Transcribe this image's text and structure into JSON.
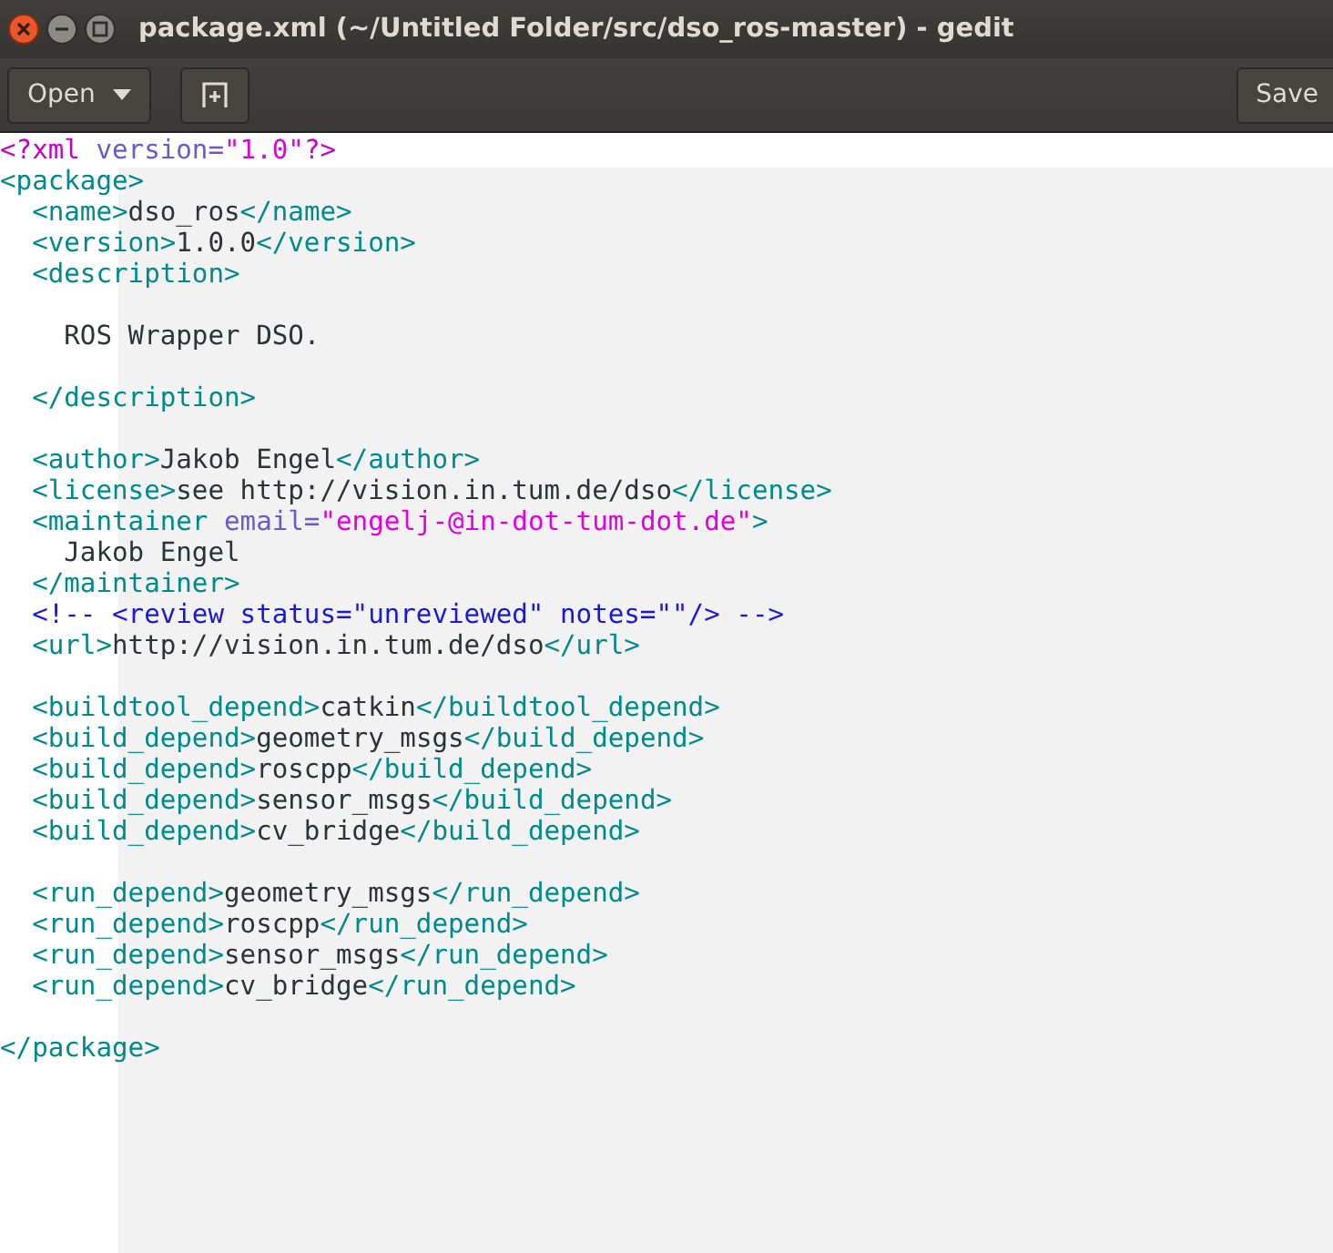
{
  "window": {
    "title": "package.xml (~/Untitled Folder/src/dso_ros-master) - gedit"
  },
  "toolbar": {
    "open_button": "Open",
    "save_button": "Save"
  },
  "editor": {
    "lines": [
      {
        "kind": "top",
        "segments": [
          {
            "kind": "pi",
            "text": "<?xml "
          },
          {
            "kind": "attr",
            "text": "version="
          },
          {
            "kind": "value",
            "text": "\"1.0\""
          },
          {
            "kind": "pi",
            "text": "?>"
          }
        ]
      },
      {
        "kind": "top",
        "segments": [
          {
            "kind": "tag",
            "text": "<package>"
          }
        ]
      },
      {
        "kind": "inner",
        "segments": [
          {
            "kind": "tag",
            "text": "<name>"
          },
          {
            "kind": "text",
            "text": "dso_ros"
          },
          {
            "kind": "tag",
            "text": "</name>"
          }
        ]
      },
      {
        "kind": "inner",
        "segments": [
          {
            "kind": "tag",
            "text": "<version>"
          },
          {
            "kind": "text",
            "text": "1.0.0"
          },
          {
            "kind": "tag",
            "text": "</version>"
          }
        ]
      },
      {
        "kind": "inner",
        "segments": [
          {
            "kind": "tag",
            "text": "<description>"
          }
        ]
      },
      {
        "kind": "blank"
      },
      {
        "kind": "inner",
        "segments": [
          {
            "kind": "text",
            "text": "  ROS Wrapper DSO."
          }
        ]
      },
      {
        "kind": "blank"
      },
      {
        "kind": "inner",
        "segments": [
          {
            "kind": "tag",
            "text": "</description>"
          }
        ]
      },
      {
        "kind": "blank"
      },
      {
        "kind": "inner",
        "segments": [
          {
            "kind": "tag",
            "text": "<author>"
          },
          {
            "kind": "text",
            "text": "Jakob Engel"
          },
          {
            "kind": "tag",
            "text": "</author>"
          }
        ]
      },
      {
        "kind": "inner",
        "segments": [
          {
            "kind": "tag",
            "text": "<license>"
          },
          {
            "kind": "text",
            "text": "see http://vision.in.tum.de/dso"
          },
          {
            "kind": "tag",
            "text": "</license>"
          }
        ]
      },
      {
        "kind": "inner",
        "segments": [
          {
            "kind": "tag",
            "text": "<maintainer "
          },
          {
            "kind": "attr",
            "text": "email="
          },
          {
            "kind": "value",
            "text": "\"engelj-@in-dot-tum-dot.de\""
          },
          {
            "kind": "tag",
            "text": ">"
          }
        ]
      },
      {
        "kind": "inner",
        "segments": [
          {
            "kind": "text",
            "text": "  Jakob Engel"
          }
        ]
      },
      {
        "kind": "inner",
        "segments": [
          {
            "kind": "tag",
            "text": "</maintainer>"
          }
        ]
      },
      {
        "kind": "inner",
        "segments": [
          {
            "kind": "comment",
            "text": "<!-- <review status=\"unreviewed\" notes=\"\"/> -->"
          }
        ]
      },
      {
        "kind": "inner",
        "segments": [
          {
            "kind": "tag",
            "text": "<url>"
          },
          {
            "kind": "text",
            "text": "http://vision.in.tum.de/dso"
          },
          {
            "kind": "tag",
            "text": "</url>"
          }
        ]
      },
      {
        "kind": "blank"
      },
      {
        "kind": "inner",
        "segments": [
          {
            "kind": "tag",
            "text": "<buildtool_depend>"
          },
          {
            "kind": "text",
            "text": "catkin"
          },
          {
            "kind": "tag",
            "text": "</buildtool_depend>"
          }
        ]
      },
      {
        "kind": "inner",
        "segments": [
          {
            "kind": "tag",
            "text": "<build_depend>"
          },
          {
            "kind": "text",
            "text": "geometry_msgs"
          },
          {
            "kind": "tag",
            "text": "</build_depend>"
          }
        ]
      },
      {
        "kind": "inner",
        "segments": [
          {
            "kind": "tag",
            "text": "<build_depend>"
          },
          {
            "kind": "text",
            "text": "roscpp"
          },
          {
            "kind": "tag",
            "text": "</build_depend>"
          }
        ]
      },
      {
        "kind": "inner",
        "segments": [
          {
            "kind": "tag",
            "text": "<build_depend>"
          },
          {
            "kind": "text",
            "text": "sensor_msgs"
          },
          {
            "kind": "tag",
            "text": "</build_depend>"
          }
        ]
      },
      {
        "kind": "inner",
        "segments": [
          {
            "kind": "tag",
            "text": "<build_depend>"
          },
          {
            "kind": "text",
            "text": "cv_bridge"
          },
          {
            "kind": "tag",
            "text": "</build_depend>"
          }
        ]
      },
      {
        "kind": "blank"
      },
      {
        "kind": "inner",
        "segments": [
          {
            "kind": "tag",
            "text": "<run_depend>"
          },
          {
            "kind": "text",
            "text": "geometry_msgs"
          },
          {
            "kind": "tag",
            "text": "</run_depend>"
          }
        ]
      },
      {
        "kind": "inner",
        "segments": [
          {
            "kind": "tag",
            "text": "<run_depend>"
          },
          {
            "kind": "text",
            "text": "roscpp"
          },
          {
            "kind": "tag",
            "text": "</run_depend>"
          }
        ]
      },
      {
        "kind": "inner",
        "segments": [
          {
            "kind": "tag",
            "text": "<run_depend>"
          },
          {
            "kind": "text",
            "text": "sensor_msgs"
          },
          {
            "kind": "tag",
            "text": "</run_depend>"
          }
        ]
      },
      {
        "kind": "inner",
        "segments": [
          {
            "kind": "tag",
            "text": "<run_depend>"
          },
          {
            "kind": "text",
            "text": "cv_bridge"
          },
          {
            "kind": "tag",
            "text": "</run_depend>"
          }
        ]
      },
      {
        "kind": "blank"
      },
      {
        "kind": "top",
        "segments": [
          {
            "kind": "tag",
            "text": "</package>"
          }
        ]
      }
    ]
  }
}
